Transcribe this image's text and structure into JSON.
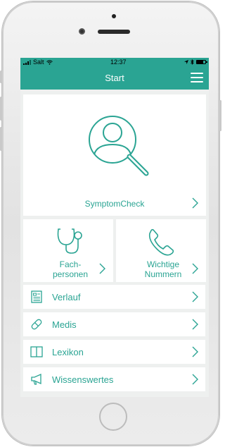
{
  "status_bar": {
    "carrier": "Salt",
    "time": "12:37"
  },
  "nav": {
    "title": "Start",
    "menu_icon": "hamburger-icon"
  },
  "symptom_check": {
    "label": "SymptomCheck",
    "icon": "person-search-icon"
  },
  "tiles": [
    {
      "label_line1": "Fach-",
      "label_line2": "personen",
      "icon": "stethoscope-icon"
    },
    {
      "label_line1": "Wichtige",
      "label_line2": "Nummern",
      "icon": "phone-icon"
    }
  ],
  "menu_items": [
    {
      "label": "Verlauf",
      "icon": "document-icon"
    },
    {
      "label": "Medis",
      "icon": "pill-icon"
    },
    {
      "label": "Lexikon",
      "icon": "book-icon"
    },
    {
      "label": "Wissenswertes",
      "icon": "megaphone-icon"
    }
  ],
  "colors": {
    "accent": "#2aa493",
    "background": "#eef0ef",
    "card": "#ffffff"
  }
}
